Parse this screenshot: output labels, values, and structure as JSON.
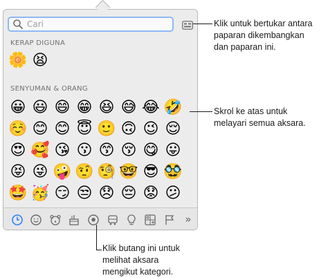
{
  "search": {
    "placeholder": "Cari"
  },
  "sections": {
    "frequent": "KERAP DIGUNA",
    "smileys": "SENYUMAN & ORANG"
  },
  "callouts": {
    "toggle_view": [
      "Klik untuk bertukar antara",
      "paparan dikembangkan",
      "dan paparan ini."
    ],
    "scroll": [
      "Skrol ke atas untuk",
      "melayari semua aksara."
    ],
    "categories": [
      "Klik butang ini untuk",
      "melihat aksara",
      "mengikut kategori."
    ]
  },
  "emoji": {
    "frequent": [
      "🌼",
      "😫"
    ],
    "smileys_rows": [
      [
        "😀",
        "😃",
        "😄",
        "😁",
        "😆",
        "😅",
        "😂",
        "🤣"
      ],
      [
        "☺️",
        "😊",
        "😊",
        "😇",
        "🙂",
        "🙃",
        "😉",
        "😌"
      ],
      [
        "😍",
        "🥰",
        "😘",
        "😗",
        "😙",
        "😚",
        "😋",
        "😛"
      ],
      [
        "😝",
        "😜",
        "🤪",
        "🤨",
        "🧐",
        "🤓",
        "😎",
        "🥸"
      ],
      [
        "🤩",
        "🥳",
        "😏",
        "😒",
        "😞",
        "😔",
        "😟",
        "😕"
      ]
    ]
  },
  "tabs": [
    {
      "icon": "clock-icon"
    },
    {
      "icon": "smiley-icon"
    },
    {
      "icon": "animal-icon"
    },
    {
      "icon": "food-icon"
    },
    {
      "icon": "ball-icon"
    },
    {
      "icon": "car-icon"
    },
    {
      "icon": "lightbulb-icon"
    },
    {
      "icon": "symbols-icon"
    },
    {
      "icon": "flag-icon"
    },
    {
      "icon": "more-icon",
      "label": "»"
    }
  ]
}
